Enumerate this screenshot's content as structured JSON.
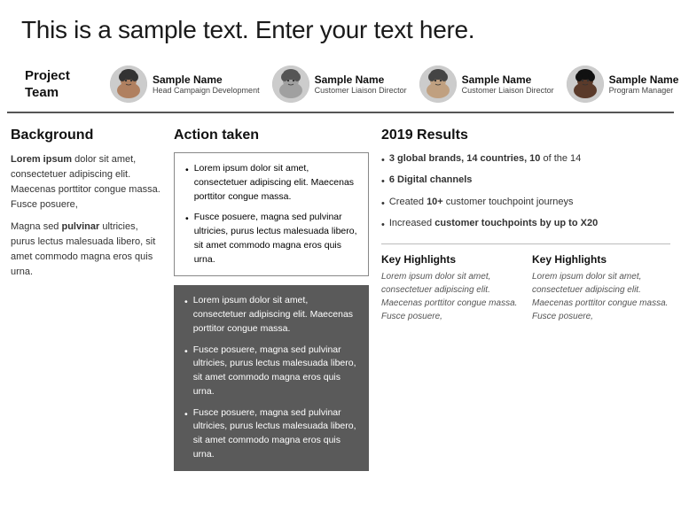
{
  "header": {
    "title": "This is a sample text. Enter your text here."
  },
  "project_team": {
    "label": "Project Team",
    "members": [
      {
        "name": "Sample Name",
        "title": "Head Campaign Development",
        "skin": "#b08060",
        "hair": "#333"
      },
      {
        "name": "Sample Name",
        "title": "Customer Liaison Director",
        "skin": "#a0a0a0",
        "hair": "#555"
      },
      {
        "name": "Sample Name",
        "title": "Customer Liaison Director",
        "skin": "#c0a080",
        "hair": "#444"
      },
      {
        "name": "Sample Name",
        "title": "Program Manager",
        "skin": "#5a3a2a",
        "hair": "#111"
      }
    ]
  },
  "sections": {
    "background": {
      "title": "Background",
      "paragraphs": [
        "Lorem ipsum dolor sit amet, consectetuer adipiscing elit. Maecenas porttitor congue massa. Fusce posuere,",
        "Magna sed pulvinar ultricies, purus lectus malesuada libero, sit amet commodo magna eros quis urna."
      ],
      "bold_words": [
        "ipsum",
        "pulvinar"
      ]
    },
    "action": {
      "title": "Action taken",
      "light_bullets": [
        "Lorem ipsum dolor sit amet, consectetuer adipiscing elit. Maecenas porttitor congue massa.",
        "Fusce posuere, magna sed pulvinar ultricies, purus lectus malesuada libero, sit amet commodo magna eros quis urna."
      ],
      "dark_bullets": [
        "Lorem ipsum dolor sit amet, consectetuer adipiscing elit. Maecenas porttitor congue massa.",
        "Fusce posuere, magna sed pulvinar ultricies, purus lectus malesuada libero, sit amet commodo magna eros quis urna.",
        "Fusce posuere, magna sed pulvinar ultricies, purus lectus malesuada libero, sit amet commodo magna eros quis urna."
      ]
    },
    "results": {
      "title": "2019 Results",
      "bullets": [
        {
          "text": "3 global brands, 14 countries, 10 of the 14",
          "bold_parts": [
            "3 global brands,",
            "14 countries,",
            "10"
          ]
        },
        {
          "text": "6 Digital channels",
          "bold_parts": [
            "6 Digital channels"
          ]
        },
        {
          "text": "Created 10+ customer touchpoint journeys",
          "bold_parts": [
            "10+"
          ]
        },
        {
          "text": "Increased customer touchpoints by up to X20",
          "bold_parts": [
            "customer touchpoints"
          ]
        }
      ],
      "highlights": [
        {
          "title": "Key Highlights",
          "text": "Lorem ipsum dolor sit amet, consectetuer adipiscing elit. Maecenas porttitor congue massa. Fusce posuere,"
        },
        {
          "title": "Key Highlights",
          "text": "Lorem ipsum dolor sit amet, consectetuer adipiscing elit. Maecenas porttitor congue massa. Fusce posuere,"
        }
      ]
    }
  }
}
